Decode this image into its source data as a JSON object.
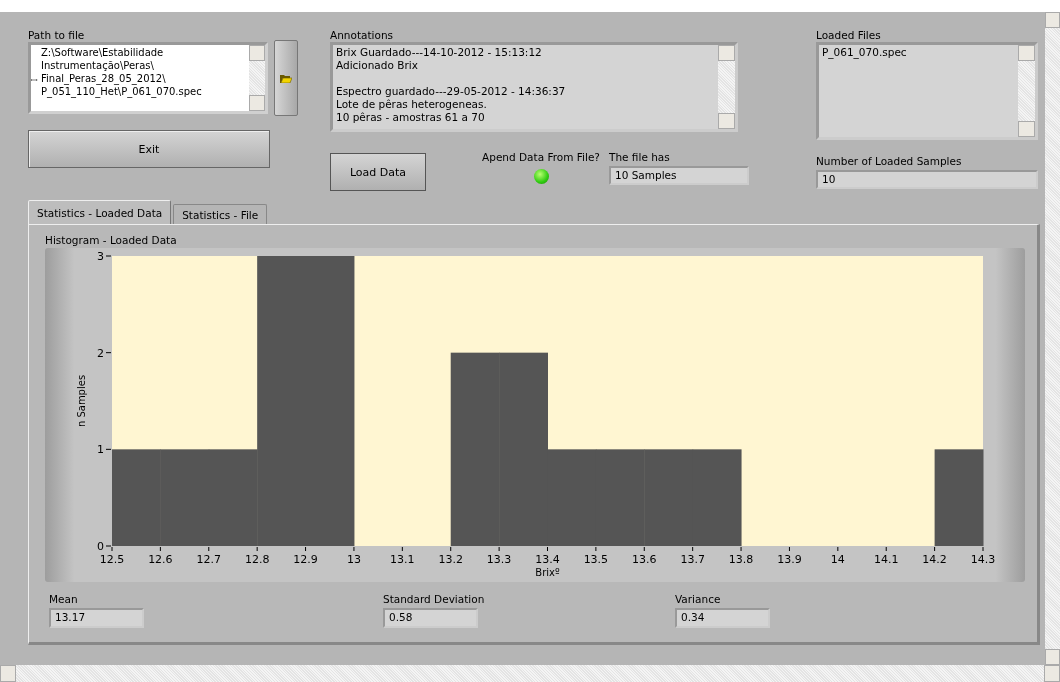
{
  "path_to_file": {
    "label": "Path to file",
    "lines": [
      "Z:\\Software\\Estabilidade",
      "Instrumentação\\Peras\\",
      "Final_Peras_28_05_2012\\",
      "P_051_110_Het\\P_061_070.spec"
    ],
    "line_marker": "ꟷ"
  },
  "exit_button": "Exit",
  "annotations": {
    "label": "Annotations",
    "paragraphs": [
      [
        "Brix Guardado---14-10-2012 - 15:13:12",
        "Adicionado Brix"
      ],
      [
        "Espectro guardado---29-05-2012 - 14:36:37",
        "Lote de pêras heterogeneas.",
        "10 pêras - amostras  61 a 70"
      ]
    ]
  },
  "load_button": "Load Data",
  "append_led": {
    "label": "Apend Data From File?",
    "on": true
  },
  "file_has": {
    "label": "The file has",
    "value": "10 Samples"
  },
  "loaded_files": {
    "label": "Loaded Files",
    "items": [
      "P_061_070.spec"
    ]
  },
  "loaded_samples": {
    "label": "Number of Loaded Samples",
    "value": "10"
  },
  "tabs": [
    {
      "label": "Statistics - Loaded Data",
      "selected": true
    },
    {
      "label": "Statistics - File",
      "selected": false
    }
  ],
  "histogram": {
    "label": "Histogram - Loaded Data",
    "chart_data": {
      "type": "bar",
      "xlabel": "Brixº",
      "ylabel": "n Samples",
      "x": [
        12.55,
        12.65,
        12.75,
        12.85,
        12.95,
        13.05,
        13.15,
        13.25,
        13.35,
        13.45,
        13.55,
        13.65,
        13.75,
        13.85,
        13.95,
        14.05,
        14.15,
        14.25
      ],
      "values": [
        1,
        1,
        1,
        3,
        3,
        0,
        0,
        2,
        2,
        1,
        1,
        1,
        1,
        0,
        0,
        0,
        0,
        1
      ],
      "xlim": [
        12.5,
        14.3
      ],
      "ylim": [
        0,
        3
      ],
      "xticks": [
        12.5,
        12.6,
        12.7,
        12.8,
        12.9,
        {
          "value": 13,
          "label": "13"
        },
        13.1,
        13.2,
        13.3,
        13.4,
        13.5,
        13.6,
        13.7,
        13.8,
        13.9,
        {
          "value": 14,
          "label": "14"
        },
        14.1,
        14.2,
        14.3
      ],
      "yticks": [
        0,
        1,
        2,
        3
      ]
    }
  },
  "stats": [
    {
      "label": "Mean",
      "value": "13.17"
    },
    {
      "label": "Standard Deviation",
      "value": "0.58"
    },
    {
      "label": "Variance",
      "value": "0.34"
    }
  ]
}
